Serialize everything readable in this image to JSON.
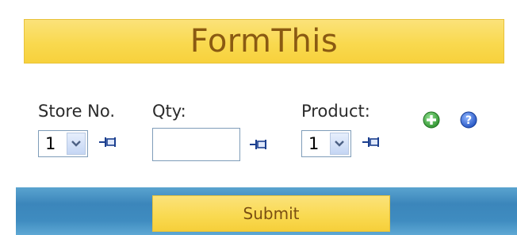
{
  "header": {
    "title": "FormThis"
  },
  "form": {
    "store": {
      "label": "Store No.",
      "selected": "1"
    },
    "qty": {
      "label": "Qty:",
      "value": ""
    },
    "product": {
      "label": "Product:",
      "selected": "1"
    }
  },
  "actions": {
    "submit_label": "Submit"
  },
  "icons": {
    "pin": "pin-icon",
    "add": "add-icon",
    "help": "help-icon"
  },
  "colors": {
    "banner": "#f9d94f",
    "title_text": "#8a5a12",
    "footer": "#3f8cc0",
    "add_green": "#3aa23a",
    "help_blue": "#1f5fd1"
  }
}
